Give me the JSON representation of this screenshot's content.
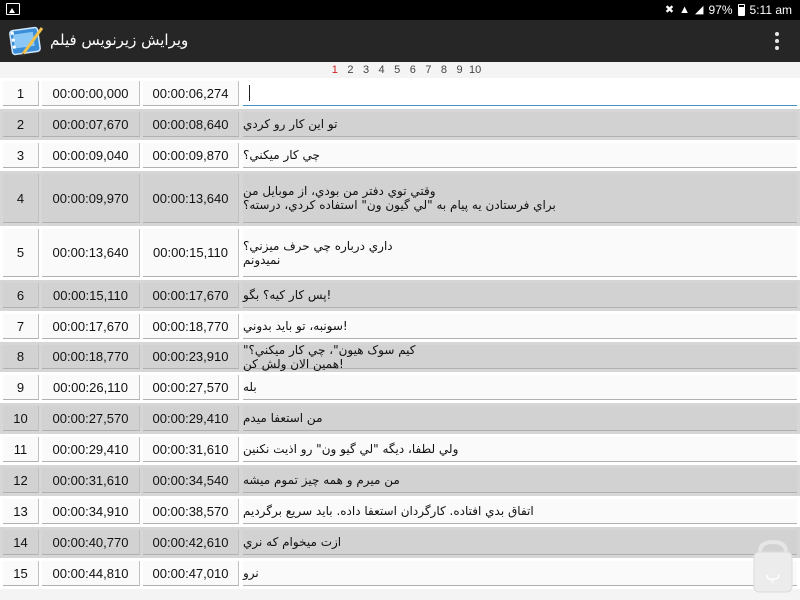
{
  "status_bar": {
    "battery_percent": "97%",
    "time": "5:11 am"
  },
  "app_bar": {
    "title": "ويرايش زيرنويس فيلم",
    "logo_icon": "film-edit-logo-icon",
    "menu_icon": "overflow-menu-icon"
  },
  "pager": {
    "pages": [
      "1",
      "2",
      "3",
      "4",
      "5",
      "6",
      "7",
      "8",
      "9",
      "10"
    ],
    "active_page": "1"
  },
  "subtitles": [
    {
      "index": "1",
      "start": "00:00:00,000",
      "end": "00:00:06,274",
      "text": ""
    },
    {
      "index": "2",
      "start": "00:00:07,670",
      "end": "00:00:08,640",
      "text": "تو اين كار رو كردي"
    },
    {
      "index": "3",
      "start": "00:00:09,040",
      "end": "00:00:09,870",
      "text": "چي كار ميكني؟"
    },
    {
      "index": "4",
      "start": "00:00:09,970",
      "end": "00:00:13,640",
      "text": "وقتي توي دفتر من بودي، از موبايل من\nبراي فرستادن يه پيام به \"لي گيون ون\" استفاده كردي، درسته؟"
    },
    {
      "index": "5",
      "start": "00:00:13,640",
      "end": "00:00:15,110",
      "text": "داري درباره چي حرف ميزني؟\nنميدونم"
    },
    {
      "index": "6",
      "start": "00:00:15,110",
      "end": "00:00:17,670",
      "text": "!پس كار كيه؟ بگو"
    },
    {
      "index": "7",
      "start": "00:00:17,670",
      "end": "00:00:18,770",
      "text": "!سونبه، تو بايد بدوني"
    },
    {
      "index": "8",
      "start": "00:00:18,770",
      "end": "00:00:23,910",
      "text": "كيم سوک هيون\"، چي كار ميكني؟\"\n!همين الان ولش كن"
    },
    {
      "index": "9",
      "start": "00:00:26,110",
      "end": "00:00:27,570",
      "text": "بله"
    },
    {
      "index": "10",
      "start": "00:00:27,570",
      "end": "00:00:29,410",
      "text": "من استعفا ميدم"
    },
    {
      "index": "11",
      "start": "00:00:29,410",
      "end": "00:00:31,610",
      "text": "ولي لطفا، ديگه \"لي گيو ون\" رو اذيت نكنين"
    },
    {
      "index": "12",
      "start": "00:00:31,610",
      "end": "00:00:34,540",
      "text": "من ميرم و همه چيز تموم ميشه"
    },
    {
      "index": "13",
      "start": "00:00:34,910",
      "end": "00:00:38,570",
      "text": "اتفاق بدي افتاده. كارگردان استعفا داده. بايد سريع برگرديم"
    },
    {
      "index": "14",
      "start": "00:00:40,770",
      "end": "00:00:42,610",
      "text": "ازت ميخوام كه نري"
    },
    {
      "index": "15",
      "start": "00:00:44,810",
      "end": "00:00:47,010",
      "text": "نرو"
    }
  ],
  "colors": {
    "app_bar": "#262626",
    "active_page": "#d32020",
    "row_light": "#ffffff",
    "row_dark": "#d6d6d6"
  }
}
